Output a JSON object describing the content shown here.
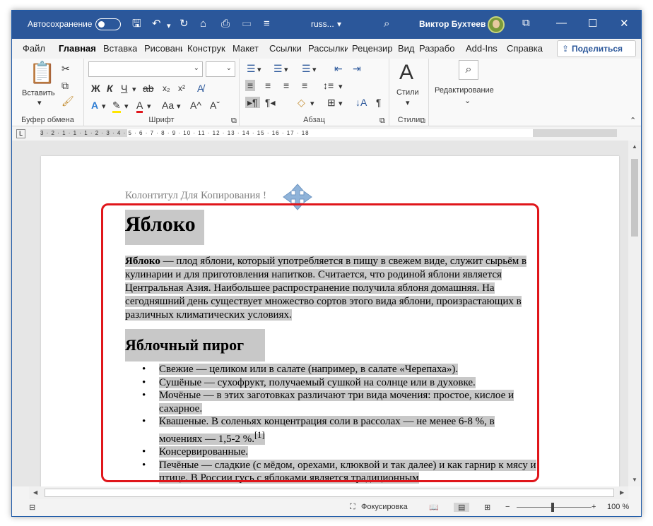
{
  "titlebar": {
    "autosave_label": "Автосохранение",
    "filename": "russ...",
    "user_name": "Виктор Бухтеев"
  },
  "tabs": [
    "Файл",
    "Главная",
    "Вставка",
    "Рисовани",
    "Конструк",
    "Макет",
    "Ссылки",
    "Рассылки",
    "Рецензир",
    "Вид",
    "Разрабо",
    "Add-Ins",
    "Справка"
  ],
  "share_label": "Поделиться",
  "ribbon": {
    "clipboard": {
      "paste_label": "Вставить",
      "group_label": "Буфер обмена"
    },
    "font": {
      "bold": "Ж",
      "italic": "К",
      "underline": "Ч",
      "strike": "ab",
      "sub": "x₂",
      "sup": "x²",
      "case": "Aa",
      "grow": "A^",
      "shrink": "Aˇ",
      "group_label": "Шрифт"
    },
    "paragraph": {
      "pilcrow": "¶",
      "group_label": "Абзац"
    },
    "styles": {
      "label": "Стили",
      "group_label": "Стили"
    },
    "editing": {
      "label": "Редактирование"
    }
  },
  "ruler": "3 · 2 · 1 · 1 · 1 · 2 · 3 · 4 · 5 · 6 · 7 · 8 · 9 · 10 · 11 · 12 · 13 · 14 · 15 · 16 · 17 · 18",
  "document": {
    "header": "Колонтитул Для Копирования !",
    "h1": "Яблоко",
    "intro_bold": "Яблоко",
    "intro_rest": " — плод яблони, который употребляется в пищу в свежем виде, служит сырьём в кулинарии и для приготовления напитков. Считается, что родиной яблони является Центральная Азия. Наибольшее распространение получила яблоня домашняя. На сегодняшний день существует множество сортов этого вида яблони, произрастающих в различных климатических условиях.",
    "h2": "Яблочный пирог",
    "list": [
      "Свежие — целиком или в салате (например, в салате «Черепаха»).",
      "Сушёные — сухофрукт, получаемый сушкой на солнце или в духовке.",
      "Мочёные — в этих заготовках различают три вида мочения: простое, кислое и сахарное.",
      "Квашеные. В соленьях концентрация соли в рассолах — не менее 6-8 %, в мочениях — 1,5-2 %.",
      "Консервированные.",
      "Печёные — сладкие (с мёдом, орехами, клюквой и так далее) и как гарнир к мясу и птице. В России гусь с яблоками является традиционным"
    ],
    "footnote": "[1]"
  },
  "status": {
    "focus_label": "Фокусировка",
    "zoom_minus": "−",
    "zoom_plus": "+",
    "zoom_value": "100 %"
  }
}
